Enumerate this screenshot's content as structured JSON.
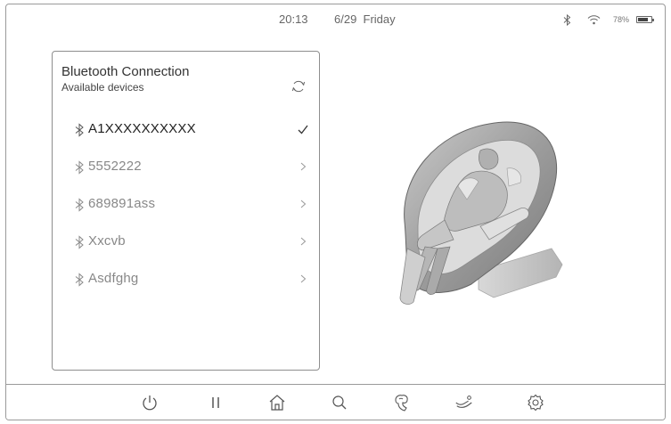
{
  "status_bar": {
    "time": "20:13",
    "date": "6/29  Friday",
    "battery_percent": "78%",
    "battery_level": 0.78,
    "icons": [
      "bluetooth-icon",
      "wifi-icon",
      "battery-icon"
    ]
  },
  "bluetooth_panel": {
    "title": "Bluetooth Connection",
    "subtitle": "Available devices",
    "refresh_icon": "refresh-icon",
    "devices": [
      {
        "name": "A1XXXXXXXXXX",
        "connected": true,
        "trailing_icon": "check-icon"
      },
      {
        "name": "5552222",
        "connected": false,
        "trailing_icon": "chevron-right-icon"
      },
      {
        "name": "689891ass",
        "connected": false,
        "trailing_icon": "chevron-right-icon"
      },
      {
        "name": "Xxcvb",
        "connected": false,
        "trailing_icon": "chevron-right-icon"
      },
      {
        "name": "Asdfghg",
        "connected": false,
        "trailing_icon": "chevron-right-icon"
      }
    ]
  },
  "bottom_nav": {
    "buttons": [
      "power-icon",
      "pause-icon",
      "home-icon",
      "search-icon",
      "massage-hand-icon",
      "recline-icon",
      "settings-icon"
    ]
  },
  "colors": {
    "border": "#9a9a9a",
    "text_primary": "#222222",
    "text_muted": "#888888",
    "icon": "#555555"
  }
}
